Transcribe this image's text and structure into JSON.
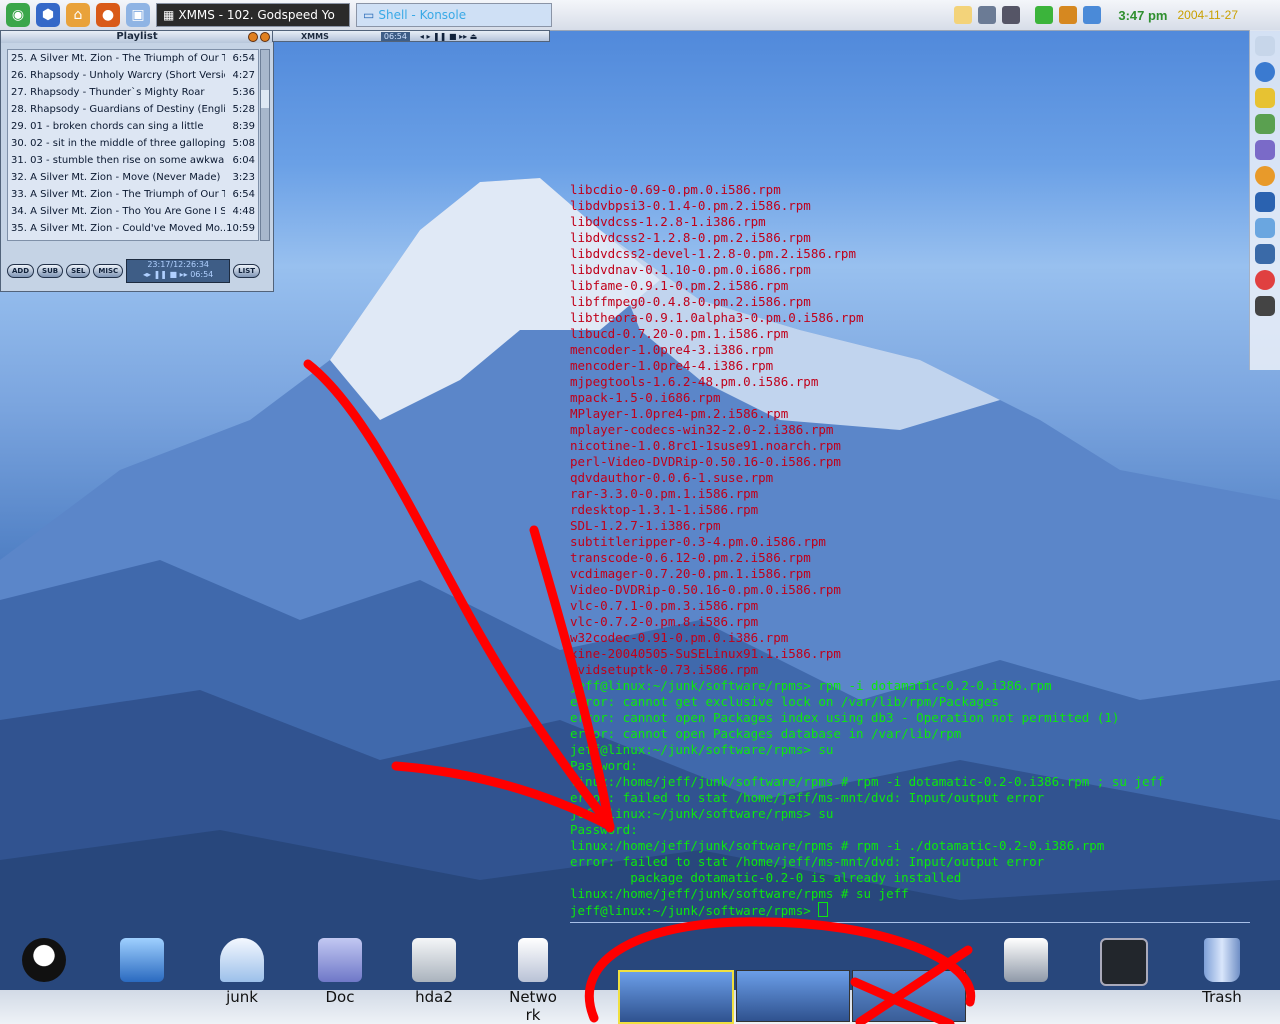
{
  "panel": {
    "launchers": [
      "suse-menu-icon",
      "suse-home-icon",
      "konqueror-icon",
      "firefox-icon",
      "desktop-icon"
    ],
    "tasks": [
      {
        "label": "XMMS - 102. Godspeed Yo",
        "active": true
      },
      {
        "label": "Shell - Konsole",
        "active": false
      }
    ],
    "clock": "3:47 pm",
    "date": "2004-11-27"
  },
  "xmms": {
    "title": "Playlist",
    "mini_title": "XMMS",
    "mini_time": "06:54",
    "tracks": [
      {
        "title": "25. A Silver Mt. Zion - The Triumph of Our Tir...",
        "dur": "6:54"
      },
      {
        "title": "26. Rhapsody - Unholy Warcry (Short Version)",
        "dur": "4:27"
      },
      {
        "title": "27. Rhapsody - Thunder`s Mighty Roar",
        "dur": "5:36"
      },
      {
        "title": "28. Rhapsody - Guardians of Destiny (English",
        "dur": "5:28"
      },
      {
        "title": "29. 01 - broken chords can sing a little",
        "dur": "8:39"
      },
      {
        "title": "30. 02 - sit in the middle of three galloping d...",
        "dur": "5:08"
      },
      {
        "title": "31. 03 - stumble then rise on some awkward ...",
        "dur": "6:04"
      },
      {
        "title": "32. A Silver Mt. Zion - Move (Never Made)",
        "dur": "3:23"
      },
      {
        "title": "33. A Silver Mt. Zion - The Triumph of Our Tir...",
        "dur": "6:54"
      },
      {
        "title": "34. A Silver Mt. Zion - Tho You Are Gone I S...",
        "dur": "4:48"
      },
      {
        "title": "35. A Silver Mt. Zion - Could've Moved Mo...",
        "dur": "10:59"
      }
    ],
    "buttons": {
      "add": "ADD",
      "sub": "SUB",
      "sel": "SEL",
      "misc": "MISC",
      "list": "LIST"
    },
    "info": "23:17/12:26:34",
    "time": "06:54"
  },
  "terminal": {
    "packages": [
      "libcdio-0.69-0.pm.0.i586.rpm",
      "libdvbpsi3-0.1.4-0.pm.2.i586.rpm",
      "libdvdcss-1.2.8-1.i386.rpm",
      "libdvdcss2-1.2.8-0.pm.2.i586.rpm",
      "libdvdcss2-devel-1.2.8-0.pm.2.i586.rpm",
      "libdvdnav-0.1.10-0.pm.0.i686.rpm",
      "libfame-0.9.1-0.pm.2.i586.rpm",
      "libffmpeg0-0.4.8-0.pm.2.i586.rpm",
      "libtheora-0.9.1.0alpha3-0.pm.0.i586.rpm",
      "libucd-0.7.20-0.pm.1.i586.rpm",
      "mencoder-1.0pre4-3.i386.rpm",
      "mencoder-1.0pre4-4.i386.rpm",
      "mjpegtools-1.6.2-48.pm.0.i586.rpm",
      "mpack-1.5-0.i686.rpm",
      "MPlayer-1.0pre4-pm.2.i586.rpm",
      "mplayer-codecs-win32-2.0-2.i386.rpm",
      "nicotine-1.0.8rc1-1suse91.noarch.rpm",
      "perl-Video-DVDRip-0.50.16-0.i586.rpm",
      "qdvdauthor-0.0.6-1.suse.rpm",
      "rar-3.3.0-0.pm.1.i586.rpm",
      "rdesktop-1.3.1-1.i586.rpm",
      "SDL-1.2.7-1.i386.rpm",
      "subtitleripper-0.3-4.pm.0.i586.rpm",
      "transcode-0.6.12-0.pm.2.i586.rpm",
      "vcdimager-0.7.20-0.pm.1.i586.rpm",
      "Video-DVDRip-0.50.16-0.pm.0.i586.rpm",
      "vlc-0.7.1-0.pm.3.i586.rpm",
      "vlc-0.7.2-0.pm.8.i586.rpm",
      "w32codec-0.91-0.pm.0.i386.rpm",
      "xine-20040505-SuSELinux91.1.i586.rpm",
      "xvidsetuptk-0.73.i586.rpm"
    ],
    "session": [
      "jeff@linux:~/junk/software/rpms> rpm -i dotamatic-0.2-0.i386.rpm",
      "error: cannot get exclusive lock on /var/lib/rpm/Packages",
      "error: cannot open Packages index using db3 - Operation not permitted (1)",
      "error: cannot open Packages database in /var/lib/rpm",
      "jeff@linux:~/junk/software/rpms> su",
      "Password:",
      "linux:/home/jeff/junk/software/rpms # rpm -i dotamatic-0.2-0.i386.rpm ; su jeff",
      "error: failed to stat /home/jeff/ms-mnt/dvd: Input/output error",
      "jeff@linux:~/junk/software/rpms> su",
      "Password:",
      "linux:/home/jeff/junk/software/rpms # rpm -i ./dotamatic-0.2-0.i386.rpm",
      "error: failed to stat /home/jeff/ms-mnt/dvd: Input/output error",
      "        package dotamatic-0.2-0 is already installed",
      "linux:/home/jeff/junk/software/rpms # su jeff"
    ],
    "prompt": "jeff@linux:~/junk/software/rpms> "
  },
  "desktop_icons": [
    {
      "name": "tux-icon",
      "label": ""
    },
    {
      "name": "my-computer-icon",
      "label": ""
    },
    {
      "name": "junk-folder-icon",
      "label": "junk"
    },
    {
      "name": "doc-folder-icon",
      "label": "Doc"
    },
    {
      "name": "hda2-drive-icon",
      "label": "hda2"
    },
    {
      "name": "network-icon",
      "label": "Netwo rk"
    },
    {
      "name": "printer-icon",
      "label": ""
    },
    {
      "name": "system-icon",
      "label": ""
    },
    {
      "name": "trash-icon",
      "label": "Trash"
    }
  ],
  "colors": {
    "terminal_red": "#c0001a",
    "terminal_green": "#0ce80c",
    "annotation": "#ff0000",
    "clock": "#2f8f2f",
    "date": "#c9a000"
  }
}
